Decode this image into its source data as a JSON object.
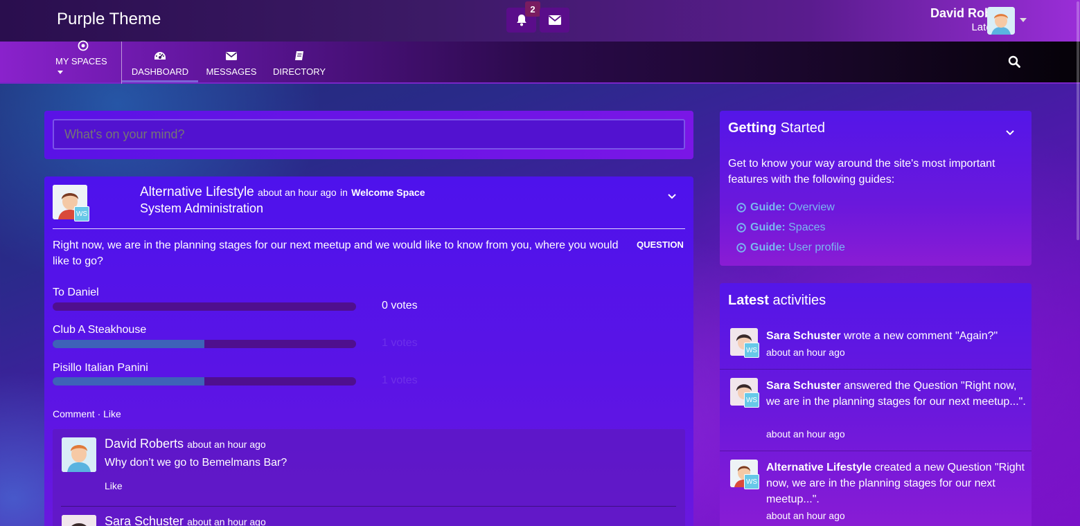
{
  "app": {
    "title": "Purple Theme"
  },
  "topbar": {
    "notifications": {
      "icon": "bell-icon",
      "count": "2"
    },
    "messages_icon": "envelope-icon",
    "user": {
      "name": "David Roberts",
      "status": "Late riser"
    }
  },
  "nav": {
    "items": [
      {
        "label": "MY SPACES",
        "icon": "target-icon"
      },
      {
        "label": "DASHBOARD",
        "icon": "dashboard-icon"
      },
      {
        "label": "MESSAGES",
        "icon": "envelope-icon"
      },
      {
        "label": "DIRECTORY",
        "icon": "book-icon"
      }
    ],
    "search_icon": "search-icon"
  },
  "composer": {
    "placeholder": "What's on your mind?"
  },
  "post": {
    "author": "Alternative Lifestyle",
    "time": "about an hour ago",
    "in_word": "in",
    "space": "Welcome Space",
    "sub": "System Administration",
    "space_badge": "WS",
    "question": "Right now, we are in the planning stages for our next meetup and we would like to know from you, where you would like to go?",
    "tag": "QUESTION",
    "poll": [
      {
        "label": "To Daniel",
        "fraction": 0,
        "votes": "0 votes"
      },
      {
        "label": "Club A Steakhouse",
        "fraction": 0.5,
        "votes": "1 votes"
      },
      {
        "label": "Pisillo Italian Panini",
        "fraction": 0.5,
        "votes": "1 votes"
      }
    ],
    "actions": {
      "comment": "Comment",
      "like": "Like"
    },
    "comments": [
      {
        "author": "David Roberts",
        "time": "about an hour ago",
        "text": "Why don’t we go to Bemelmans Bar?",
        "like": "Like"
      },
      {
        "author": "Sara Schuster",
        "time": "about an hour ago"
      }
    ]
  },
  "getting_started": {
    "title_bold": "Getting",
    "title_rest": "Started",
    "description": "Get to know your way around the site's most important features with the following guides:",
    "guides": [
      {
        "prefix": "Guide:",
        "label": "Overview"
      },
      {
        "prefix": "Guide:",
        "label": "Spaces"
      },
      {
        "prefix": "Guide:",
        "label": "User profile"
      }
    ]
  },
  "latest_activities": {
    "title_bold": "Latest",
    "title_rest": "activities",
    "items": [
      {
        "actor": "Sara Schuster",
        "text": "wrote a new comment \"Again?\"",
        "time": "about an hour ago"
      },
      {
        "actor": "Sara Schuster",
        "text": "answered the Question \"Right now, we are in the planning stages for our next meetup...\".",
        "time": "about an hour ago"
      },
      {
        "actor": "Alternative Lifestyle",
        "text": "created a new Question \"Right now, we are in the planning stages for our next meetup...\".",
        "time": "about an hour ago"
      }
    ]
  },
  "colors": {
    "accent": "#7d63d6",
    "poll_fill": "#3e62b8",
    "ws_badge": "#67c8e8"
  }
}
